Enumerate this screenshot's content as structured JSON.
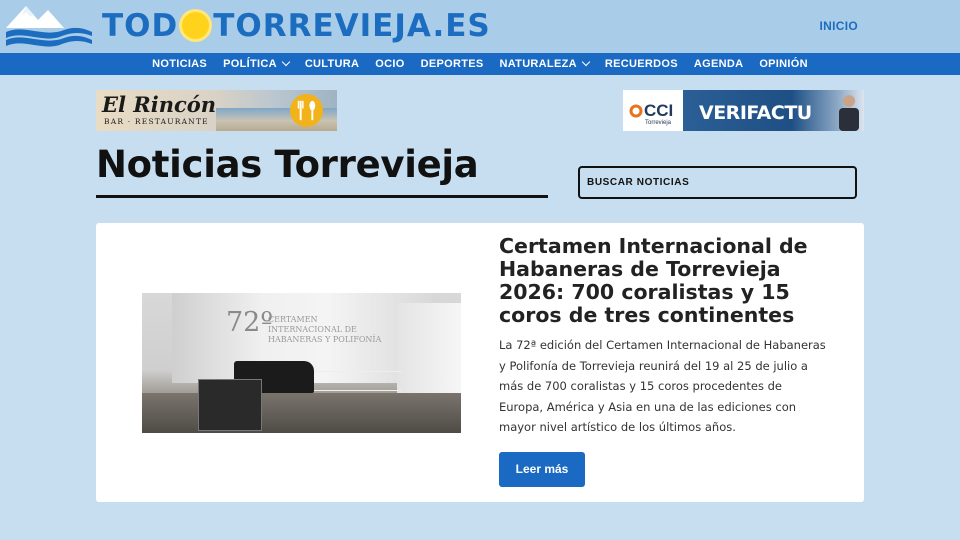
{
  "header": {
    "logo_prefix": "TOD",
    "logo_suffix": "TORREVIEJA.ES",
    "inicio_label": "INICIO"
  },
  "nav": {
    "items": [
      {
        "label": "NOTICIAS",
        "has_dropdown": false
      },
      {
        "label": "POLÍTICA",
        "has_dropdown": true
      },
      {
        "label": "CULTURA",
        "has_dropdown": false
      },
      {
        "label": "OCIO",
        "has_dropdown": false
      },
      {
        "label": "DEPORTES",
        "has_dropdown": false
      },
      {
        "label": "NATURALEZA",
        "has_dropdown": true
      },
      {
        "label": "RECUERDOS",
        "has_dropdown": false
      },
      {
        "label": "AGENDA",
        "has_dropdown": false
      },
      {
        "label": "OPINIÓN",
        "has_dropdown": false
      }
    ]
  },
  "ads": {
    "left": {
      "title": "El Rincón",
      "subtitle": "BAR · RESTAURANTE"
    },
    "right": {
      "brand": "CCI",
      "brand_sub": "Torrevieja",
      "headline": "VERIFACTU"
    }
  },
  "page": {
    "title": "Noticias Torrevieja"
  },
  "search": {
    "placeholder": "BUSCAR NOTICIAS"
  },
  "article": {
    "image_text_number": "72º",
    "image_text_lines": "CERTAMEN INTERNACIONAL DE HABANERAS Y POLIFONÍA",
    "title": "Certamen Internacional de Habaneras de Torrevieja 2026: 700 coralistas y 15 coros de tres continentes",
    "excerpt": "La 72ª edición del Certamen Internacional de Habaneras y Polifonía de Torrevieja reunirá del 19 al 25 de julio a más de 700 coralistas y 15 coros procedentes de Europa, América y Asia en una de las ediciones con mayor nivel artístico de los últimos años.",
    "read_more_label": "Leer más"
  },
  "colors": {
    "page_bg": "#c6def0",
    "header_bg": "#a9cde9",
    "nav_bg": "#1a6ac3",
    "brand_blue": "#1c6cc0",
    "sun_yellow": "#ffd21c"
  }
}
